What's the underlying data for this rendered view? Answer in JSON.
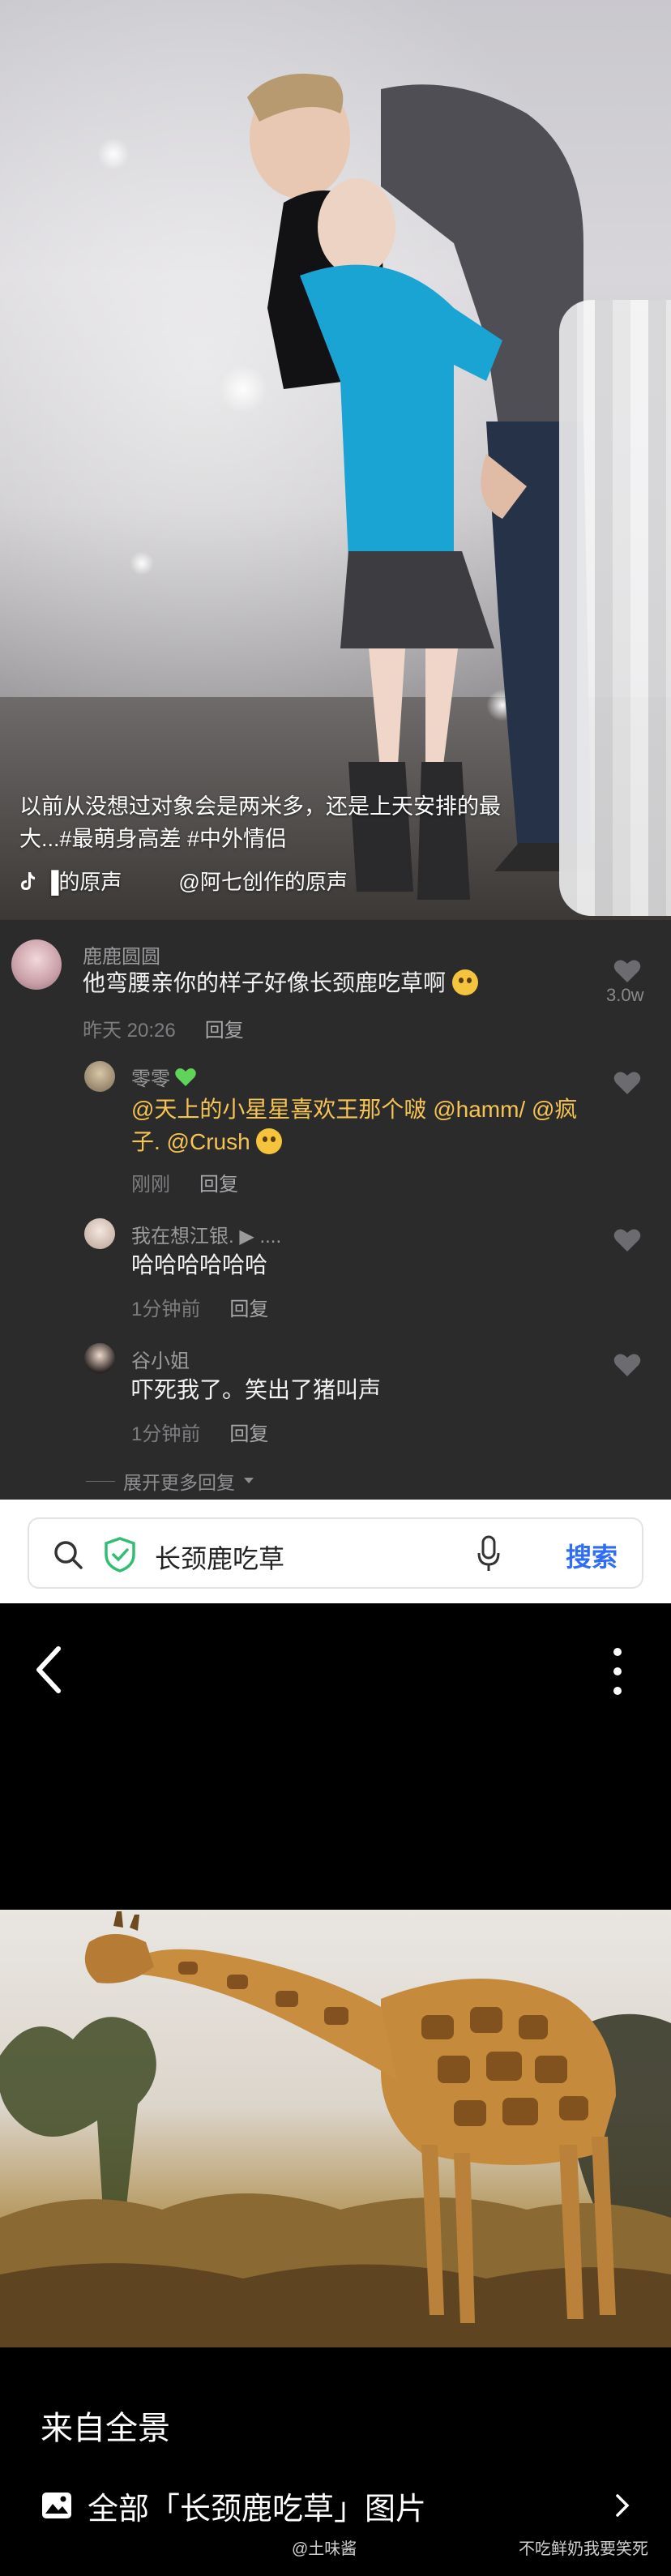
{
  "video": {
    "caption": "以前从没想过对象会是两米多，还是上天安排的最大...#最萌身高差 #中外情侣",
    "music_left": "▐的原声",
    "music_right": "@阿七创作的原声"
  },
  "comments": [
    {
      "user": "鹿鹿圆圆",
      "text": "他弯腰亲你的样子好像长颈鹿吃草啊",
      "time": "昨天 20:26",
      "reply_label": "回复",
      "likes": "3.0w"
    },
    {
      "user": "零零",
      "text_mention1": "@天上的小星星喜欢王那个啵 @hamm/ @疯子. @Crush",
      "time": "刚刚",
      "reply_label": "回复"
    },
    {
      "user": "我在想江银.  ▶  ....",
      "text": "哈哈哈哈哈哈",
      "time": "1分钟前",
      "reply_label": "回复"
    },
    {
      "user": "谷小姐",
      "text": "吓死我了。笑出了猪叫声",
      "time": "1分钟前",
      "reply_label": "回复"
    }
  ],
  "expand_label": "展开更多回复",
  "search": {
    "query": "长颈鹿吃草",
    "button": "搜索"
  },
  "viewer": {
    "from_label": "来自全景",
    "all_images_label": "全部「长颈鹿吃草」图片"
  },
  "watermarks": {
    "left": "@土味酱",
    "right": "不吃鲜奶我要笑死"
  },
  "colors": {
    "mention": "#f6c452",
    "search_button": "#2f6df6",
    "comment_bg": "#2b2b2c"
  }
}
